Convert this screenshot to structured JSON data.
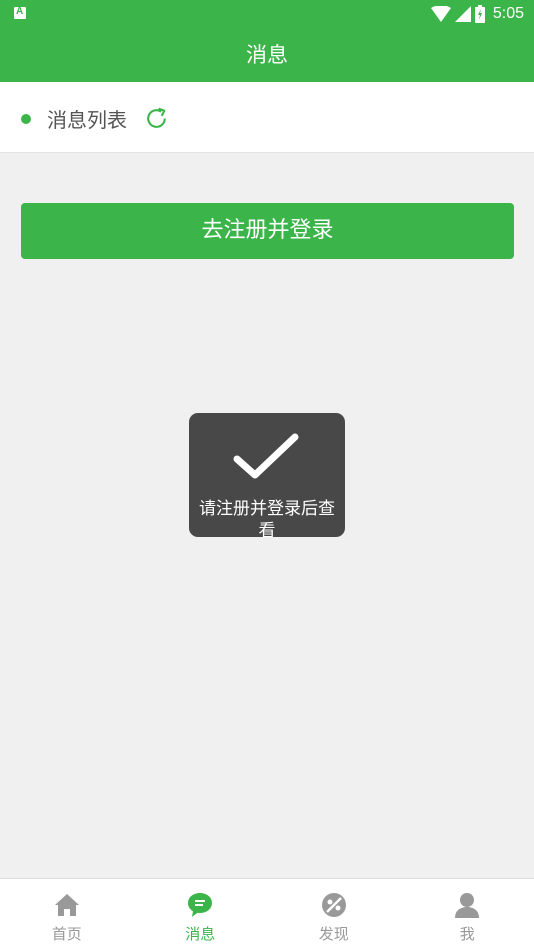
{
  "status_bar": {
    "time": "5:05"
  },
  "header": {
    "title": "消息"
  },
  "list_header": {
    "label": "消息列表"
  },
  "register_button": {
    "label": "去注册并登录"
  },
  "toast": {
    "message": "请注册并登录后查看"
  },
  "bottom_nav": {
    "items": [
      {
        "label": "首页",
        "icon": "home-icon",
        "active": false
      },
      {
        "label": "消息",
        "icon": "message-icon",
        "active": true
      },
      {
        "label": "发现",
        "icon": "discover-icon",
        "active": false
      },
      {
        "label": "我",
        "icon": "person-icon",
        "active": false
      }
    ]
  },
  "colors": {
    "primary": "#3bb54a",
    "background": "#f0f0f0",
    "toast_bg": "#484848",
    "inactive": "#999999"
  }
}
